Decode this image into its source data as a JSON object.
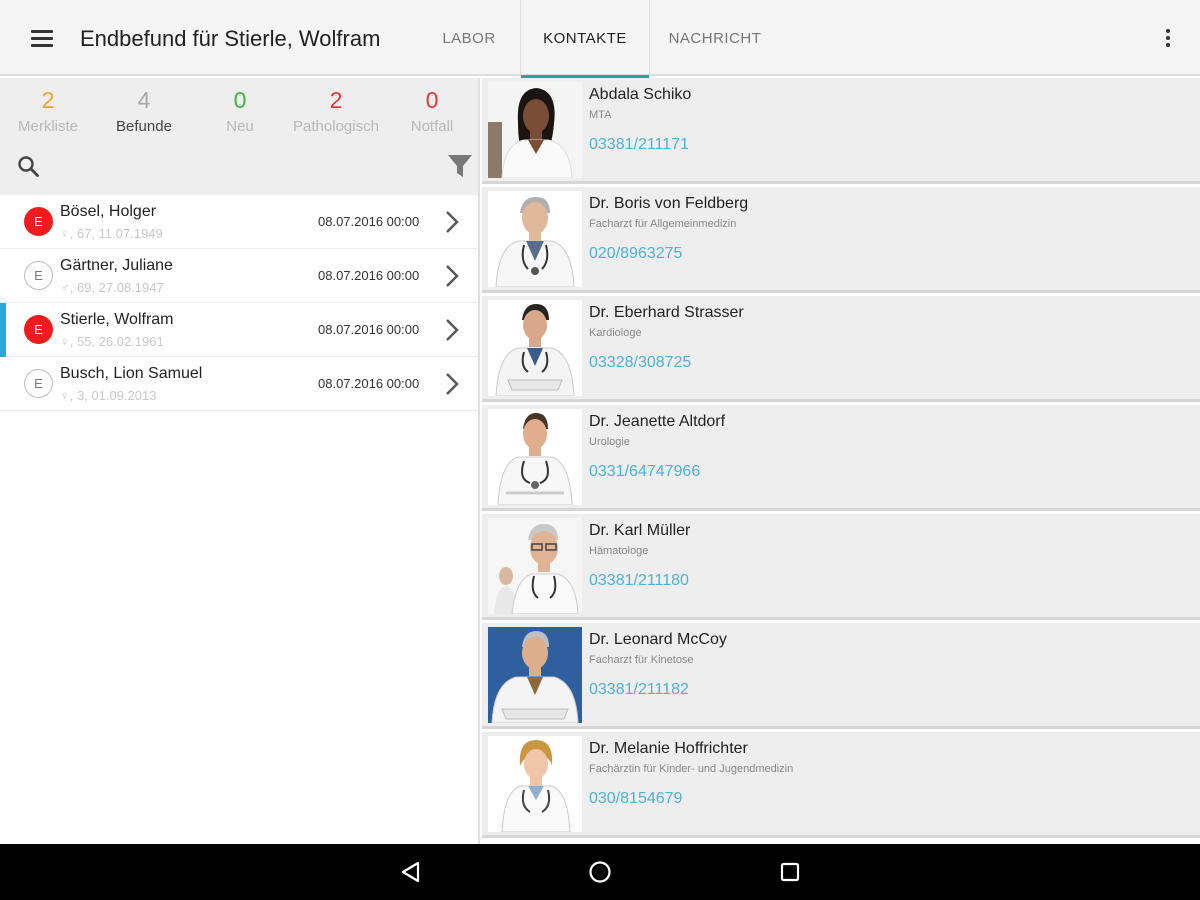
{
  "app_bar": {
    "title": "Endbefund für Stierle, Wolfram",
    "tabs": [
      {
        "label": "LABOR",
        "active": false
      },
      {
        "label": "KONTAKTE",
        "active": true
      },
      {
        "label": "NACHRICHT",
        "active": false
      }
    ],
    "menu_icon": "hamburger-menu-icon",
    "overflow_icon": "more-vertical-icon"
  },
  "stats": [
    {
      "value": "2",
      "label": "Merkliste",
      "value_color": "#f0a030",
      "label_color": "#b8b8b8"
    },
    {
      "value": "4",
      "label": "Befunde",
      "value_color": "#a8a8a8",
      "label_color": "#444444"
    },
    {
      "value": "0",
      "label": "Neu",
      "value_color": "#3cba3c",
      "label_color": "#b8b8b8"
    },
    {
      "value": "2",
      "label": "Pathologisch",
      "value_color": "#e53935",
      "label_color": "#b8b8b8"
    },
    {
      "value": "0",
      "label": "Notfall",
      "value_color": "#e53935",
      "label_color": "#b8b8b8"
    }
  ],
  "toolbar": {
    "search_icon": "search-icon",
    "filter_icon": "filter-icon"
  },
  "patients": [
    {
      "badge": "E",
      "badge_style": "red",
      "name": "Bösel, Holger",
      "info": "♀, 67, 11.07.1949",
      "date": "08.07.2016 00:00",
      "selected": false
    },
    {
      "badge": "E",
      "badge_style": "outline",
      "name": "Gärtner, Juliane",
      "info": "♂, 69, 27.08.1947",
      "date": "08.07.2016 00:00",
      "selected": false
    },
    {
      "badge": "E",
      "badge_style": "red",
      "name": "Stierle, Wolfram",
      "info": "♀, 55, 26.02.1961",
      "date": "08.07.2016 00:00",
      "selected": true
    },
    {
      "badge": "E",
      "badge_style": "outline",
      "name": "Busch, Lion Samuel",
      "info": "♀, 3, 01.09.2013",
      "date": "08.07.2016 00:00",
      "selected": false
    }
  ],
  "contacts": [
    {
      "name": "Abdala Schiko",
      "role": "MTA",
      "phone": "03381/211171",
      "photo": "female-staff-portrait"
    },
    {
      "name": "Dr. Boris von Feldberg",
      "role": "Facharzt für Allgemeinmedizin",
      "phone": "020/8963275",
      "photo": "male-doctor-portrait"
    },
    {
      "name": "Dr. Eberhard Strasser",
      "role": "Kardiologe",
      "phone": "03328/308725",
      "photo": "male-doctor-portrait"
    },
    {
      "name": "Dr. Jeanette Altdorf",
      "role": "Urologie",
      "phone": "0331/64747966",
      "photo": "male-doctor-portrait"
    },
    {
      "name": "Dr. Karl Müller",
      "role": "Hämatologe",
      "phone": "03381/211180",
      "photo": "male-doctor-portrait"
    },
    {
      "name": "Dr. Leonard McCoy",
      "role": "Facharzt für Kinetose",
      "phone": "03381/211182",
      "photo": "male-doctor-portrait-blue-bg"
    },
    {
      "name": "Dr. Melanie Hoffrichter",
      "role": "Fachärztin für Kinder- und Jugendmedizin",
      "phone": "030/8154679",
      "photo": "female-doctor-portrait"
    }
  ],
  "navbar": {
    "back_icon": "back-triangle-icon",
    "home_icon": "home-circle-icon",
    "recent_icon": "recent-apps-square-icon"
  }
}
